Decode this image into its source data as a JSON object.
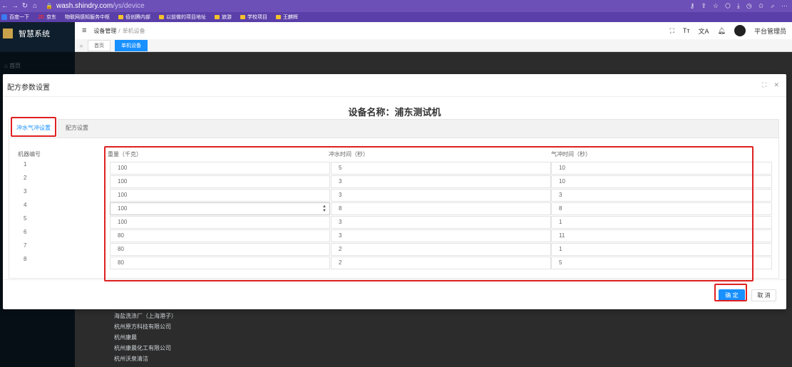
{
  "browser": {
    "url_host": "wash.shindry.com",
    "url_path": "/ys/device",
    "bookmarks": [
      "百度一下",
      "京东",
      "物联网感知服务中枢",
      "佰创腾内部",
      "以前做的项目地址",
      "旅游",
      "学校项目",
      "王麒辉"
    ]
  },
  "app": {
    "system_title": "智慧系统",
    "home_label": "首页",
    "breadcrumb_parent": "设备管理",
    "breadcrumb_current": "单机设备",
    "user_label": "平台管理员",
    "tabs": [
      "首页",
      "单机设备"
    ],
    "background_list": [
      "海盐洗涤厂（上海港子）",
      "杭州原方科技有限公司",
      "杭州康晨",
      "杭州康晨化工有限公司",
      "杭州沃泉清洁"
    ]
  },
  "dialog": {
    "title": "配方参数设置",
    "device_prefix": "设备名称：",
    "device_name": "浦东测试机",
    "tabs": [
      "冲水气冲设置",
      "配方设置"
    ],
    "machine_no_header": "机器编号",
    "columns": [
      "重量（千克）",
      "冲水时间（秒）",
      "气冲时间（秒）"
    ],
    "rows": [
      {
        "no": "1",
        "weight": "100",
        "flush": "5",
        "air": "10"
      },
      {
        "no": "2",
        "weight": "100",
        "flush": "3",
        "air": "10"
      },
      {
        "no": "3",
        "weight": "100",
        "flush": "3",
        "air": "3"
      },
      {
        "no": "4",
        "weight": "100",
        "flush": "8",
        "air": "8"
      },
      {
        "no": "5",
        "weight": "100",
        "flush": "3",
        "air": "1"
      },
      {
        "no": "6",
        "weight": "80",
        "flush": "3",
        "air": "11"
      },
      {
        "no": "7",
        "weight": "80",
        "flush": "2",
        "air": "1"
      },
      {
        "no": "8",
        "weight": "80",
        "flush": "2",
        "air": "5"
      }
    ],
    "confirm_label": "确 定",
    "cancel_label": "取 消"
  }
}
